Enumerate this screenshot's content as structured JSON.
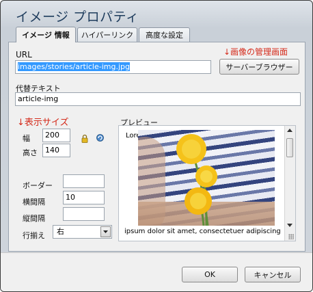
{
  "dialog": {
    "title": "イメージ プロパティ"
  },
  "tabs": [
    {
      "label": "イメージ 情報"
    },
    {
      "label": "ハイパーリンク"
    },
    {
      "label": "高度な設定"
    }
  ],
  "annotations": {
    "browser": "↓画像の管理画面",
    "size": "↓表示サイズ"
  },
  "url": {
    "label": "URL",
    "value": "images/stories/article-img.jpg"
  },
  "browse_button": "サーバーブラウザー",
  "alt": {
    "label": "代替テキスト",
    "value": "article-img"
  },
  "width": {
    "label": "幅",
    "value": "200"
  },
  "height": {
    "label": "高さ",
    "value": "140"
  },
  "border": {
    "label": "ボーダー",
    "value": ""
  },
  "hspace": {
    "label": "横間隔",
    "value": "10"
  },
  "vspace": {
    "label": "縦間隔",
    "value": ""
  },
  "align": {
    "label": "行揃え",
    "value": "右"
  },
  "preview": {
    "label": "プレビュー",
    "text_top": "Lorem",
    "text_bottom": "ipsum dolor sit amet, consectetuer adipiscing"
  },
  "footer": {
    "ok": "OK",
    "cancel": "キャンセル"
  },
  "icons": {
    "lock": "lock-icon",
    "reset": "reset-size-icon",
    "dropdown": "chevron-down-icon"
  }
}
